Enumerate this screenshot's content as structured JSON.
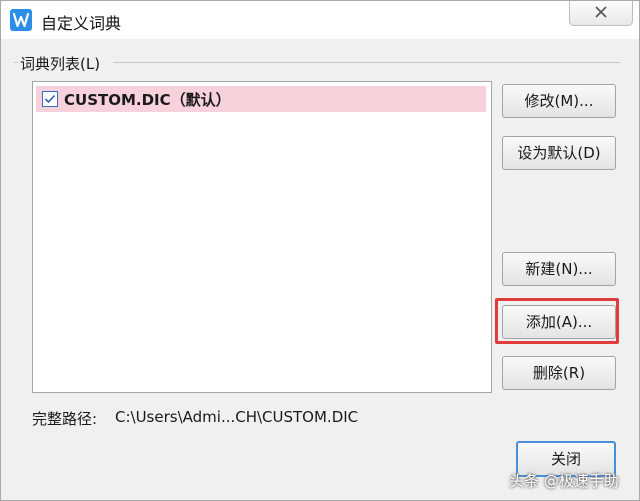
{
  "window": {
    "title": "自定义词典",
    "icon": "wps-writer-icon"
  },
  "dictionary_group": {
    "label": "词典列表(L)",
    "items": [
      {
        "label": "CUSTOM.DIC（默认）",
        "checked": true,
        "selected": true
      }
    ]
  },
  "buttons": {
    "modify": "修改(M)...",
    "set_default": "设为默认(D)",
    "new": "新建(N)...",
    "add": "添加(A)...",
    "delete": "删除(R)",
    "close": "关闭"
  },
  "path": {
    "label": "完整路径:",
    "value": "C:\\Users\\Admi...CH\\CUSTOM.DIC"
  },
  "watermark": "头条 @极速手助",
  "colors": {
    "accent": "#2a8ee8",
    "selection": "#f7d2dc",
    "highlight": "#e03c3c"
  }
}
